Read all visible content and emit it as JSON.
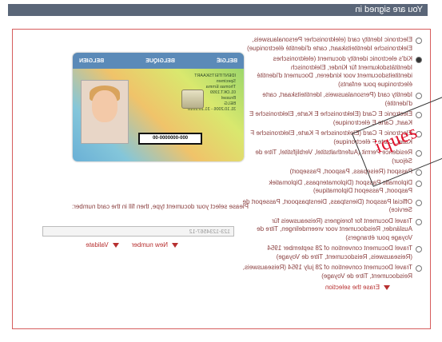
{
  "header": {
    "title": "You are signed in"
  },
  "options": [
    {
      "label": "Electronic Identity card (elektronischer Personalausweis, Elektronische Identiteitskaart, carte d'identité électronique)",
      "selected": false
    },
    {
      "label": "Kid's electronic identity document (elektronisches Identitätsdokument für Kinder, Elektronisch identiteitsdocument voor kinderen, Document d'identité électronique pour enfants)",
      "selected": true
    },
    {
      "label": "Identity card (Personalausweis, Identiteitskaart, carte d'identité)",
      "selected": false
    },
    {
      "label": "Electronic E Card (Elektronische E Karte, Elektronische E Kaart, Carte E électronique)",
      "selected": false
    },
    {
      "label": "Electronic F Card (Elektronische F Karte, Elektronische F Kaart, Carte F électronique)",
      "selected": false
    },
    {
      "label": "Residence Permit (Aufenthaltstitel, Verblijfstitel, Titre de Séjour)",
      "selected": false
    },
    {
      "label": "Passport (Reisepass, Paspoort, Passeport)",
      "selected": false
    },
    {
      "label": "Diplomatic Passport (Diplomatenpass, Diplomatiek Paspoort, Passeport Diplomatique)",
      "selected": false
    },
    {
      "label": "Official Passport (Dienstpass, Dienstpaspoort, Passeport de Service)",
      "selected": false
    },
    {
      "label": "Travel Document for foreigners (Reiseausweis für Ausländer, Reisdocument voor vreemdelingen, Titre de Voyage pour étrangers)",
      "selected": false
    },
    {
      "label": "Travel Document convention of 28 september 1954 (Reiseausweis, Reisdocument, Titre de Voyage)",
      "selected": false
    },
    {
      "label": "Travel Document convention of 28 july 1954 (Reiseausweis, Reisdocument, Titre de Voyage)",
      "selected": false
    }
  ],
  "erase_label": "Erase the selection",
  "card": {
    "country_left": "BELGIË",
    "country_mid": "BELGIQUE",
    "country_right": "BELGIEN",
    "doc_title": "IDENTITEITSKAART",
    "surname": "Specimen",
    "given": "Thomas Emma",
    "nationality": "BELG",
    "birth": "01.OKT.1999",
    "place": "Brussel",
    "number": "000-0000000-00",
    "validity": "31.10.2006 - 31.10.2016"
  },
  "instruction": "Please select your document type, then fill in the card number:",
  "card_number_value": "123-1234567-12",
  "actions": {
    "new_number": "New number",
    "validate": "Validate"
  },
  "stamp_text": "iques",
  "colors": {
    "accent": "#b73030",
    "header_bg": "#5a6678",
    "border": "#d65d5d"
  }
}
